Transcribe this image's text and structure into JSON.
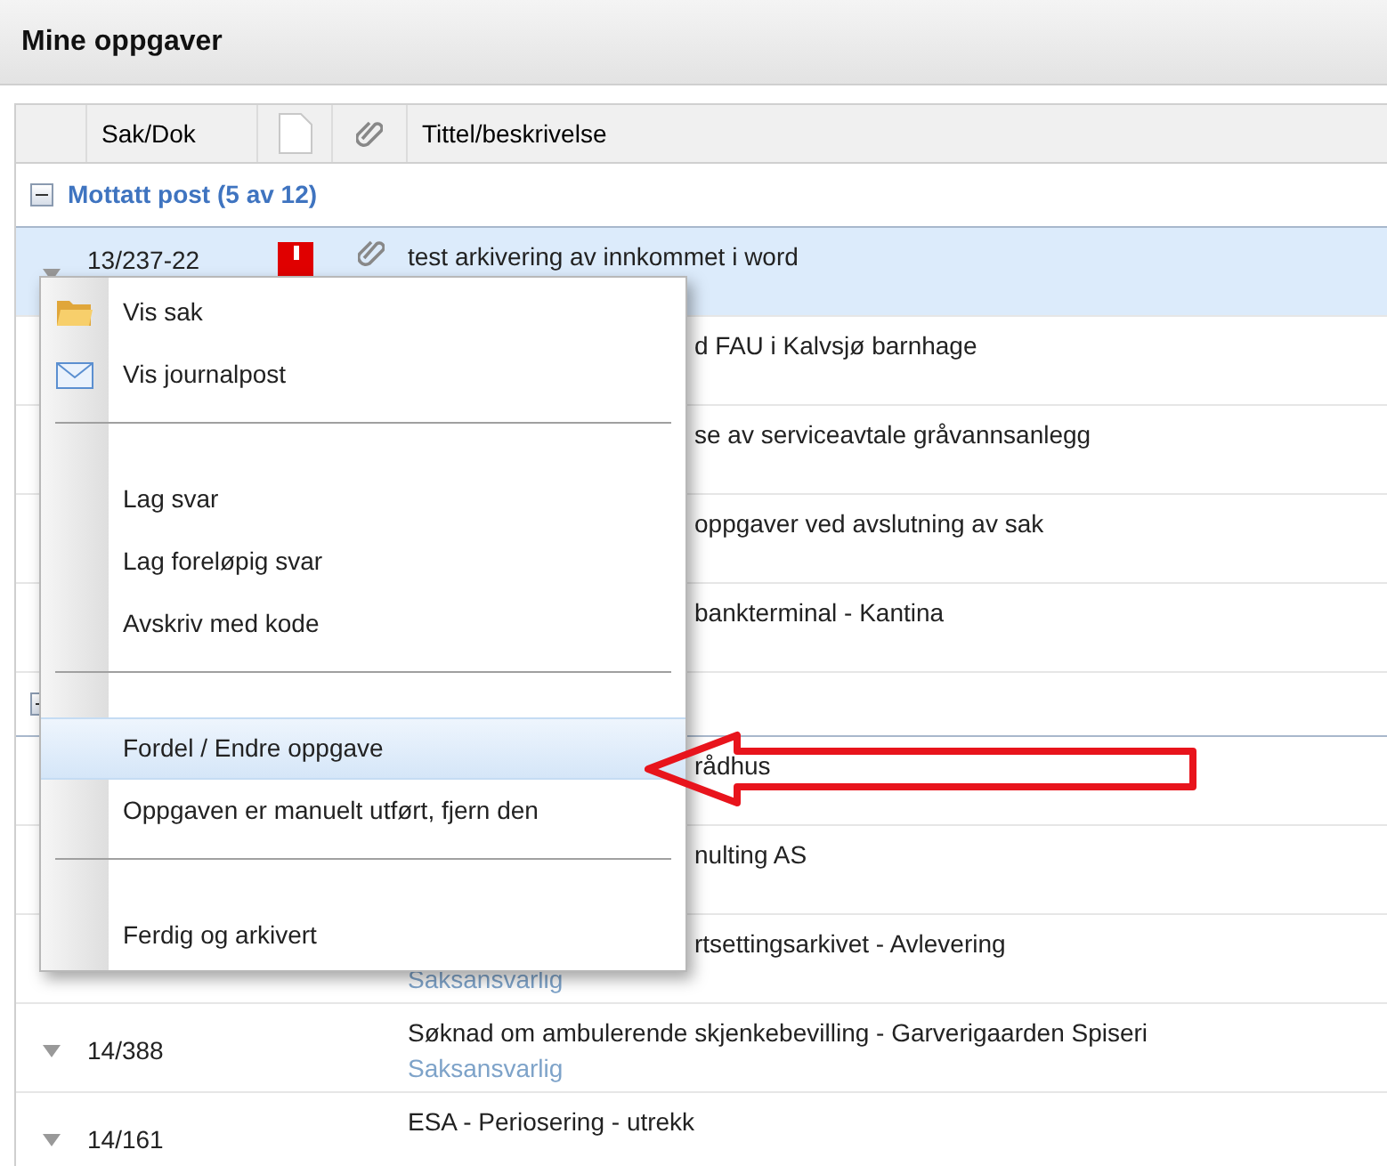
{
  "title": "Mine oppgaver",
  "columns": {
    "case": "Sak/Dok",
    "title": "Tittel/beskrivelse"
  },
  "groups": [
    {
      "label": "Mottatt post (5 av 12)",
      "expanded": true,
      "rows": [
        {
          "sak": "13/237-22",
          "urgent": true,
          "attachment": true,
          "title": "test arkivering av innkommet i word",
          "selected": true
        },
        {
          "kind": "covered",
          "title": "d FAU i Kalvsjø barnhage",
          "selected": false
        },
        {
          "kind": "covered",
          "title": "se av serviceavtale gråvannsanlegg",
          "selected": false
        },
        {
          "kind": "covered",
          "title": "oppgaver ved avslutning av sak",
          "selected": false
        },
        {
          "kind": "covered",
          "title": "bankterminal - Kantina",
          "selected": false
        }
      ]
    },
    {
      "expanded": true,
      "rows": [
        {
          "kind": "covered",
          "title": "rådhus",
          "selected": false
        },
        {
          "kind": "covered",
          "title": "nulting AS",
          "selected": false
        },
        {
          "kind": "covered",
          "title": "rtsettingsarkivet - Avlevering",
          "subtitle": "Saksansvarlig",
          "selected": false
        },
        {
          "sak": "14/388",
          "title": "Søknad om ambulerende skjenkebevilling - Garverigaarden Spiseri",
          "subtitle": "Saksansvarlig",
          "selected": false
        },
        {
          "sak": "14/161",
          "title": "ESA - Periosering - utrekk",
          "selected": false
        }
      ]
    }
  ],
  "menu": [
    {
      "kind": "item",
      "label": "Vis sak",
      "selected": false
    },
    {
      "kind": "item",
      "label": "Vis journalpost",
      "selected": false
    },
    {
      "kind": "separator"
    },
    {
      "kind": "item",
      "label": "Lag svar",
      "selected": false
    },
    {
      "kind": "item",
      "label": "Lag foreløpig svar",
      "selected": false
    },
    {
      "kind": "item",
      "label": "Avskriv med kode",
      "selected": false
    },
    {
      "kind": "separator"
    },
    {
      "kind": "item",
      "label": "Fordel / Endre oppgave",
      "selected": true
    },
    {
      "kind": "item",
      "label": "Oppgaven er manuelt utført, fjern den",
      "selected": false
    },
    {
      "kind": "separator"
    },
    {
      "kind": "item",
      "label": "Ferdig og arkivert",
      "selected": false
    }
  ]
}
